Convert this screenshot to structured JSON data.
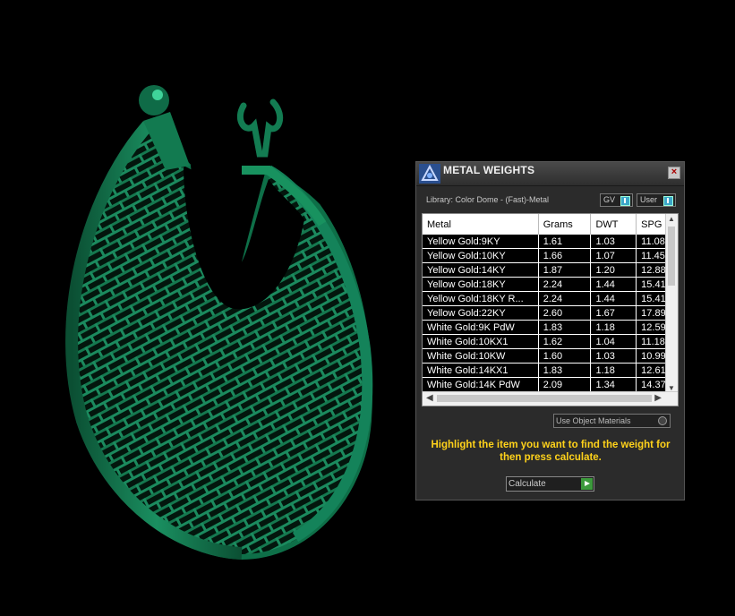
{
  "colors": {
    "model": "#0f6b47",
    "highlight": "#3fd39a",
    "hint": "#ffd21a"
  },
  "panel": {
    "title": "METAL WEIGHTS",
    "close_icon": "close-icon",
    "library_label": "Library: Color Dome - (Fast)-Metal",
    "toggle_gv": "GV",
    "toggle_user": "User",
    "columns": [
      "Metal",
      "Grams",
      "DWT",
      "SPG"
    ],
    "rows": [
      [
        "Yellow Gold:9KY",
        "1.61",
        "1.03",
        "11.08"
      ],
      [
        "Yellow Gold:10KY",
        "1.66",
        "1.07",
        "11.45"
      ],
      [
        "Yellow Gold:14KY",
        "1.87",
        "1.20",
        "12.88"
      ],
      [
        "Yellow Gold:18KY",
        "2.24",
        "1.44",
        "15.41"
      ],
      [
        "Yellow Gold:18KY R...",
        "2.24",
        "1.44",
        "15.41"
      ],
      [
        "Yellow Gold:22KY",
        "2.60",
        "1.67",
        "17.89"
      ],
      [
        "White Gold:9K PdW",
        "1.83",
        "1.18",
        "12.59"
      ],
      [
        "White Gold:10KX1",
        "1.62",
        "1.04",
        "11.18"
      ],
      [
        "White Gold:10KW",
        "1.60",
        "1.03",
        "10.99"
      ],
      [
        "White Gold:14KX1",
        "1.83",
        "1.18",
        "12.61"
      ],
      [
        "White Gold:14K PdW",
        "2.09",
        "1.34",
        "14.37"
      ]
    ],
    "use_object_materials": "Use Object Materials",
    "hint": "Highlight the item you want to find the weight for then press calculate.",
    "calculate_label": "Calculate"
  }
}
